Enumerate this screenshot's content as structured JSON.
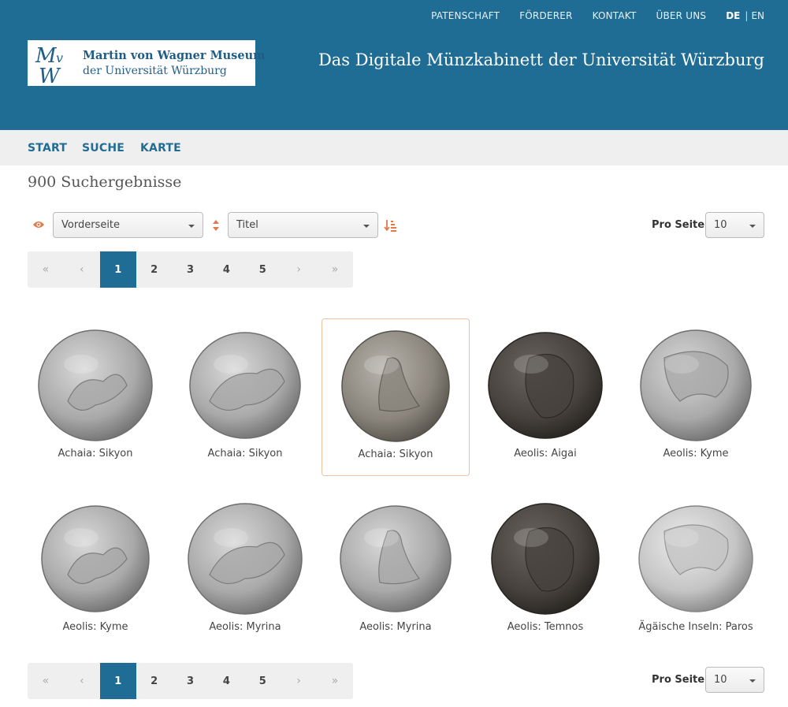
{
  "header": {
    "top_links": [
      "PATENSCHAFT",
      "FÖRDERER",
      "KONTAKT",
      "ÜBER UNS"
    ],
    "lang_active": "DE",
    "lang_separator": "|",
    "lang_other": "EN",
    "logo_line1": "Martin von Wagner Museum",
    "logo_line2": "der Universität Würzburg",
    "logo_mark": "MvW",
    "site_title": "Das Digitale Münzkabinett der Universität Würzburg"
  },
  "nav": {
    "items": [
      "START",
      "SUCHE",
      "KARTE"
    ]
  },
  "results": {
    "count_text": "900 Suchergebnisse"
  },
  "controls": {
    "view_select": "Vorderseite",
    "sort_select": "Titel",
    "per_page_label": "Pro Seite",
    "per_page_value": "10"
  },
  "pagination": {
    "first": "«",
    "prev": "‹",
    "pages": [
      "1",
      "2",
      "3",
      "4",
      "5"
    ],
    "active_page": "1",
    "next": "›",
    "last": "»"
  },
  "coins": [
    {
      "label": "Achaia: Sikyon",
      "tone": "silver"
    },
    {
      "label": "Achaia: Sikyon",
      "tone": "silver"
    },
    {
      "label": "Achaia: Sikyon",
      "tone": "silver-dark"
    },
    {
      "label": "Aeolis: Aigai",
      "tone": "bronze-dark"
    },
    {
      "label": "Aeolis: Kyme",
      "tone": "silver"
    },
    {
      "label": "Aeolis: Kyme",
      "tone": "silver"
    },
    {
      "label": "Aeolis: Myrina",
      "tone": "silver"
    },
    {
      "label": "Aeolis: Myrina",
      "tone": "silver"
    },
    {
      "label": "Aeolis: Temnos",
      "tone": "bronze-dark"
    },
    {
      "label": "Ägäische Inseln: Paros",
      "tone": "silver-light"
    }
  ],
  "selected_coin_index": 2,
  "colors": {
    "brand": "#1f6c94",
    "accent": "#e07a4a",
    "selected_border": "#f0c0a6"
  }
}
